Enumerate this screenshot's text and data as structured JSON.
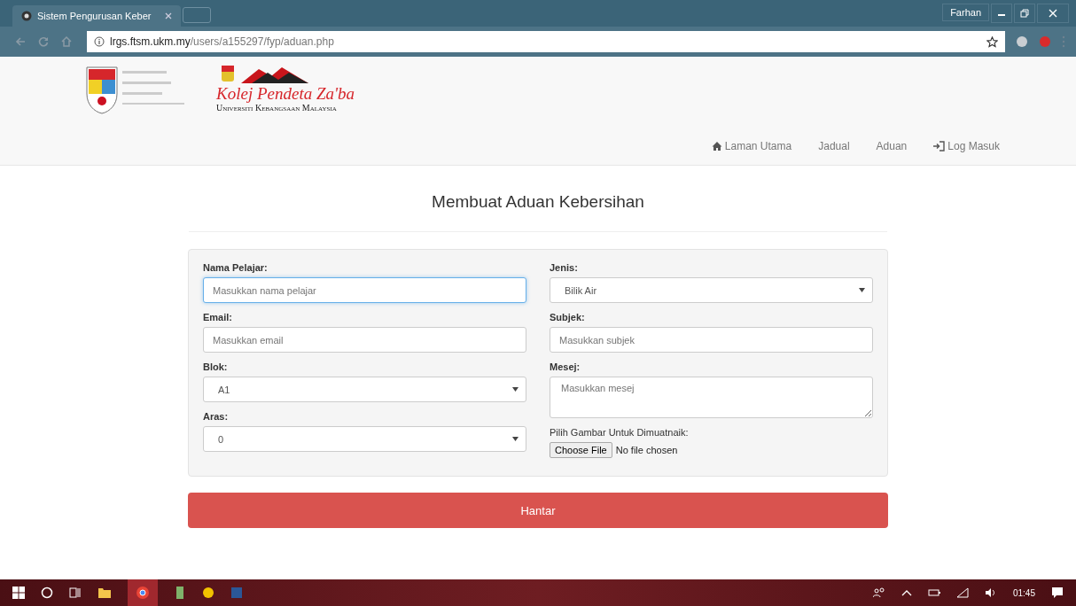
{
  "browser": {
    "tab_title": "Sistem Pengurusan Keber",
    "profile": "Farhan",
    "url_host": "lrgs.ftsm.ukm.my",
    "url_path": "/users/a155297/fyp/aduan.php"
  },
  "header": {
    "logo_title": "Kolej Pendeta Za'ba",
    "logo_subtitle": "Universiti Kebangsaan Malaysia",
    "nav": [
      {
        "label": "Laman Utama",
        "kind": "home"
      },
      {
        "label": "Jadual",
        "kind": "plain"
      },
      {
        "label": "Aduan",
        "kind": "plain"
      },
      {
        "label": "Log Masuk",
        "kind": "login"
      }
    ]
  },
  "page_title": "Membuat Aduan Kebersihan",
  "form": {
    "left": [
      {
        "label": "Nama Pelajar:",
        "kind": "text",
        "placeholder": "Masukkan nama pelajar",
        "focused": true
      },
      {
        "label": "Email:",
        "kind": "text",
        "placeholder": "Masukkan email",
        "focused": false
      },
      {
        "label": "Blok:",
        "kind": "select",
        "value": "A1",
        "focused": false
      },
      {
        "label": "Aras:",
        "kind": "select",
        "value": "0",
        "focused": false
      }
    ],
    "right": [
      {
        "label": "Jenis:",
        "kind": "select",
        "value": "Bilik Air",
        "focused": false
      },
      {
        "label": "Subjek:",
        "kind": "text",
        "placeholder": "Masukkan subjek",
        "focused": false
      },
      {
        "label": "Mesej:",
        "kind": "textarea",
        "placeholder": "Masukkan mesej",
        "focused": false
      },
      {
        "label": "Pilih Gambar Untuk Dimuatnaik:",
        "kind": "file",
        "button": "Choose File",
        "status": "No file chosen"
      }
    ]
  },
  "submit": "Hantar",
  "taskbar": {
    "clock": "01:45"
  }
}
